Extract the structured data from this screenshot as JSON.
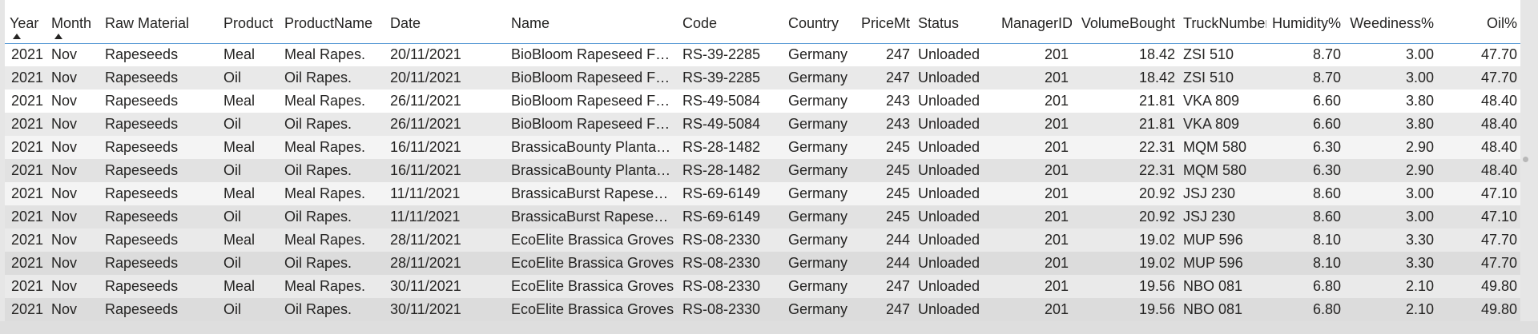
{
  "table": {
    "columns": [
      {
        "label": "Year",
        "numeric": true,
        "sorted": true
      },
      {
        "label": "Month",
        "numeric": false,
        "sorted": true
      },
      {
        "label": "Raw Material",
        "numeric": false
      },
      {
        "label": "Product",
        "numeric": false
      },
      {
        "label": "ProductName",
        "numeric": false
      },
      {
        "label": "Date",
        "numeric": false
      },
      {
        "label": "Name",
        "numeric": false
      },
      {
        "label": "Code",
        "numeric": false
      },
      {
        "label": "Country",
        "numeric": false
      },
      {
        "label": "PriceMt",
        "numeric": true
      },
      {
        "label": "Status",
        "numeric": false
      },
      {
        "label": "ManagerID",
        "numeric": true
      },
      {
        "label": "VolumeBought",
        "numeric": true
      },
      {
        "label": "TruckNumber",
        "numeric": false
      },
      {
        "label": "Humidity%",
        "numeric": true
      },
      {
        "label": "Weediness%",
        "numeric": true
      },
      {
        "label": "Oil%",
        "numeric": true
      }
    ],
    "rows": [
      [
        "2021",
        "Nov",
        "Rapeseeds",
        "Meal",
        "Meal Rapes.",
        "20/11/2021",
        "BioBloom Rapeseed Fa...",
        "RS-39-2285",
        "Germany",
        "247",
        "Unloaded",
        "201",
        "18.42",
        "ZSI 510",
        "8.70",
        "3.00",
        "47.70"
      ],
      [
        "2021",
        "Nov",
        "Rapeseeds",
        "Oil",
        "Oil Rapes.",
        "20/11/2021",
        "BioBloom Rapeseed Fa...",
        "RS-39-2285",
        "Germany",
        "247",
        "Unloaded",
        "201",
        "18.42",
        "ZSI 510",
        "8.70",
        "3.00",
        "47.70"
      ],
      [
        "2021",
        "Nov",
        "Rapeseeds",
        "Meal",
        "Meal Rapes.",
        "26/11/2021",
        "BioBloom Rapeseed Fa...",
        "RS-49-5084",
        "Germany",
        "243",
        "Unloaded",
        "201",
        "21.81",
        "VKA 809",
        "6.60",
        "3.80",
        "48.40"
      ],
      [
        "2021",
        "Nov",
        "Rapeseeds",
        "Oil",
        "Oil Rapes.",
        "26/11/2021",
        "BioBloom Rapeseed Fa...",
        "RS-49-5084",
        "Germany",
        "243",
        "Unloaded",
        "201",
        "21.81",
        "VKA 809",
        "6.60",
        "3.80",
        "48.40"
      ],
      [
        "2021",
        "Nov",
        "Rapeseeds",
        "Meal",
        "Meal Rapes.",
        "16/11/2021",
        "BrassicaBounty Plantati...",
        "RS-28-1482",
        "Germany",
        "245",
        "Unloaded",
        "201",
        "22.31",
        "MQM 580",
        "6.30",
        "2.90",
        "48.40"
      ],
      [
        "2021",
        "Nov",
        "Rapeseeds",
        "Oil",
        "Oil Rapes.",
        "16/11/2021",
        "BrassicaBounty Plantati...",
        "RS-28-1482",
        "Germany",
        "245",
        "Unloaded",
        "201",
        "22.31",
        "MQM 580",
        "6.30",
        "2.90",
        "48.40"
      ],
      [
        "2021",
        "Nov",
        "Rapeseeds",
        "Meal",
        "Meal Rapes.",
        "11/11/2021",
        "BrassicaBurst Rapeseeds",
        "RS-69-6149",
        "Germany",
        "245",
        "Unloaded",
        "201",
        "20.92",
        "JSJ 230",
        "8.60",
        "3.00",
        "47.10"
      ],
      [
        "2021",
        "Nov",
        "Rapeseeds",
        "Oil",
        "Oil Rapes.",
        "11/11/2021",
        "BrassicaBurst Rapeseeds",
        "RS-69-6149",
        "Germany",
        "245",
        "Unloaded",
        "201",
        "20.92",
        "JSJ 230",
        "8.60",
        "3.00",
        "47.10"
      ],
      [
        "2021",
        "Nov",
        "Rapeseeds",
        "Meal",
        "Meal Rapes.",
        "28/11/2021",
        "EcoElite Brassica Groves",
        "RS-08-2330",
        "Germany",
        "244",
        "Unloaded",
        "201",
        "19.02",
        "MUP 596",
        "8.10",
        "3.30",
        "47.70"
      ],
      [
        "2021",
        "Nov",
        "Rapeseeds",
        "Oil",
        "Oil Rapes.",
        "28/11/2021",
        "EcoElite Brassica Groves",
        "RS-08-2330",
        "Germany",
        "244",
        "Unloaded",
        "201",
        "19.02",
        "MUP 596",
        "8.10",
        "3.30",
        "47.70"
      ],
      [
        "2021",
        "Nov",
        "Rapeseeds",
        "Meal",
        "Meal Rapes.",
        "30/11/2021",
        "EcoElite Brassica Groves",
        "RS-08-2330",
        "Germany",
        "247",
        "Unloaded",
        "201",
        "19.56",
        "NBO 081",
        "6.80",
        "2.10",
        "49.80"
      ],
      [
        "2021",
        "Nov",
        "Rapeseeds",
        "Oil",
        "Oil Rapes.",
        "30/11/2021",
        "EcoElite Brassica Groves",
        "RS-08-2330",
        "Germany",
        "247",
        "Unloaded",
        "201",
        "19.56",
        "NBO 081",
        "6.80",
        "2.10",
        "49.80"
      ]
    ]
  },
  "colors": {
    "header_rule": "#5a9bd5",
    "text": "#252423",
    "background": "#e6e6e6"
  }
}
